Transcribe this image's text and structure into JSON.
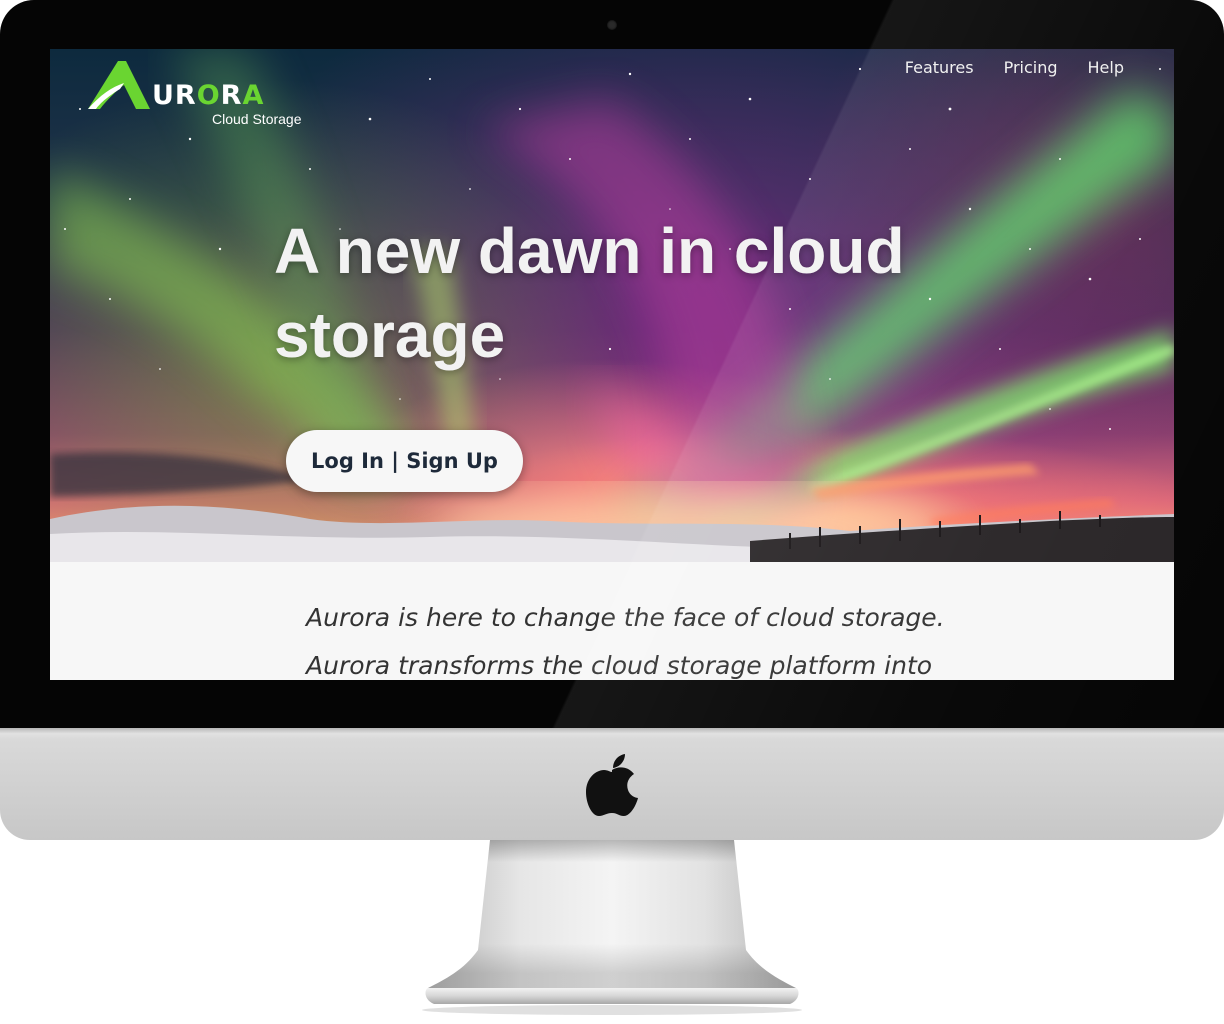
{
  "site": {
    "brand": {
      "word_white_1": "UR",
      "word_green": "O",
      "word_white_2": "R",
      "word_green_2": "A",
      "subtitle": "Cloud Storage",
      "logo_icon": "aurora-a-logo-icon"
    },
    "nav": {
      "items": [
        {
          "label": "Features"
        },
        {
          "label": "Pricing"
        },
        {
          "label": "Help"
        }
      ]
    },
    "hero": {
      "headline_line1": "A new dawn in cloud",
      "headline_line2": "storage",
      "cta_label": "Log In | Sign Up"
    },
    "intro": {
      "line1": "Aurora is here to change the face of cloud storage.",
      "line2": "Aurora transforms the cloud storage platform into"
    }
  },
  "device": {
    "brand_icon": "apple-icon"
  },
  "colors": {
    "accent_green": "#6ad531",
    "bezel": "#050505",
    "aluminum": "#d4d4d4",
    "cta_text": "#1e2a3a"
  }
}
